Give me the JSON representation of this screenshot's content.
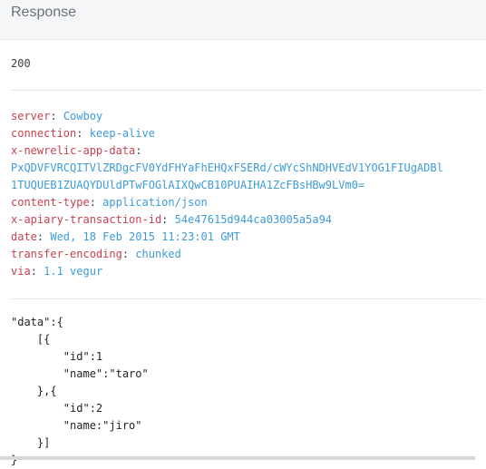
{
  "panel": {
    "title": "Response"
  },
  "status_code": "200",
  "headers": [
    {
      "key": "server",
      "value": "Cowboy"
    },
    {
      "key": "connection",
      "value": "keep-alive"
    },
    {
      "key": "x-newrelic-app-data",
      "value": ""
    },
    {
      "key": "",
      "value": "PxQDVFVRCQITVlZRDgcFV0YdFHYaFhEHQxFSERd/cWYcShNDHVEdV1YOG1FIUgADBl"
    },
    {
      "key": "",
      "value": "1TUQUEB1ZUAQYDUldPTwFOGlAIXQwCB10PUAIHA1ZcFBsHBw9LVm0="
    },
    {
      "key": "content-type",
      "value": "application/json"
    },
    {
      "key": "x-apiary-transaction-id",
      "value": "54e47615d944ca03005a5a94"
    },
    {
      "key": "date",
      "value": "Wed, 18 Feb 2015 11:23:01 GMT"
    },
    {
      "key": "transfer-encoding",
      "value": "chunked"
    },
    {
      "key": "via",
      "value": "1.1 vegur"
    }
  ],
  "body_lines": [
    "\"data\":{",
    "    [{",
    "        \"id\":1",
    "        \"name\":\"taro\"",
    "    },{",
    "        \"id\":2",
    "        \"name:\"jiro\"",
    "    }]",
    "}"
  ],
  "colors": {
    "header_key": "#c6424f",
    "header_value": "#3d9bd6",
    "panel_bg": "#f5f6f8"
  }
}
